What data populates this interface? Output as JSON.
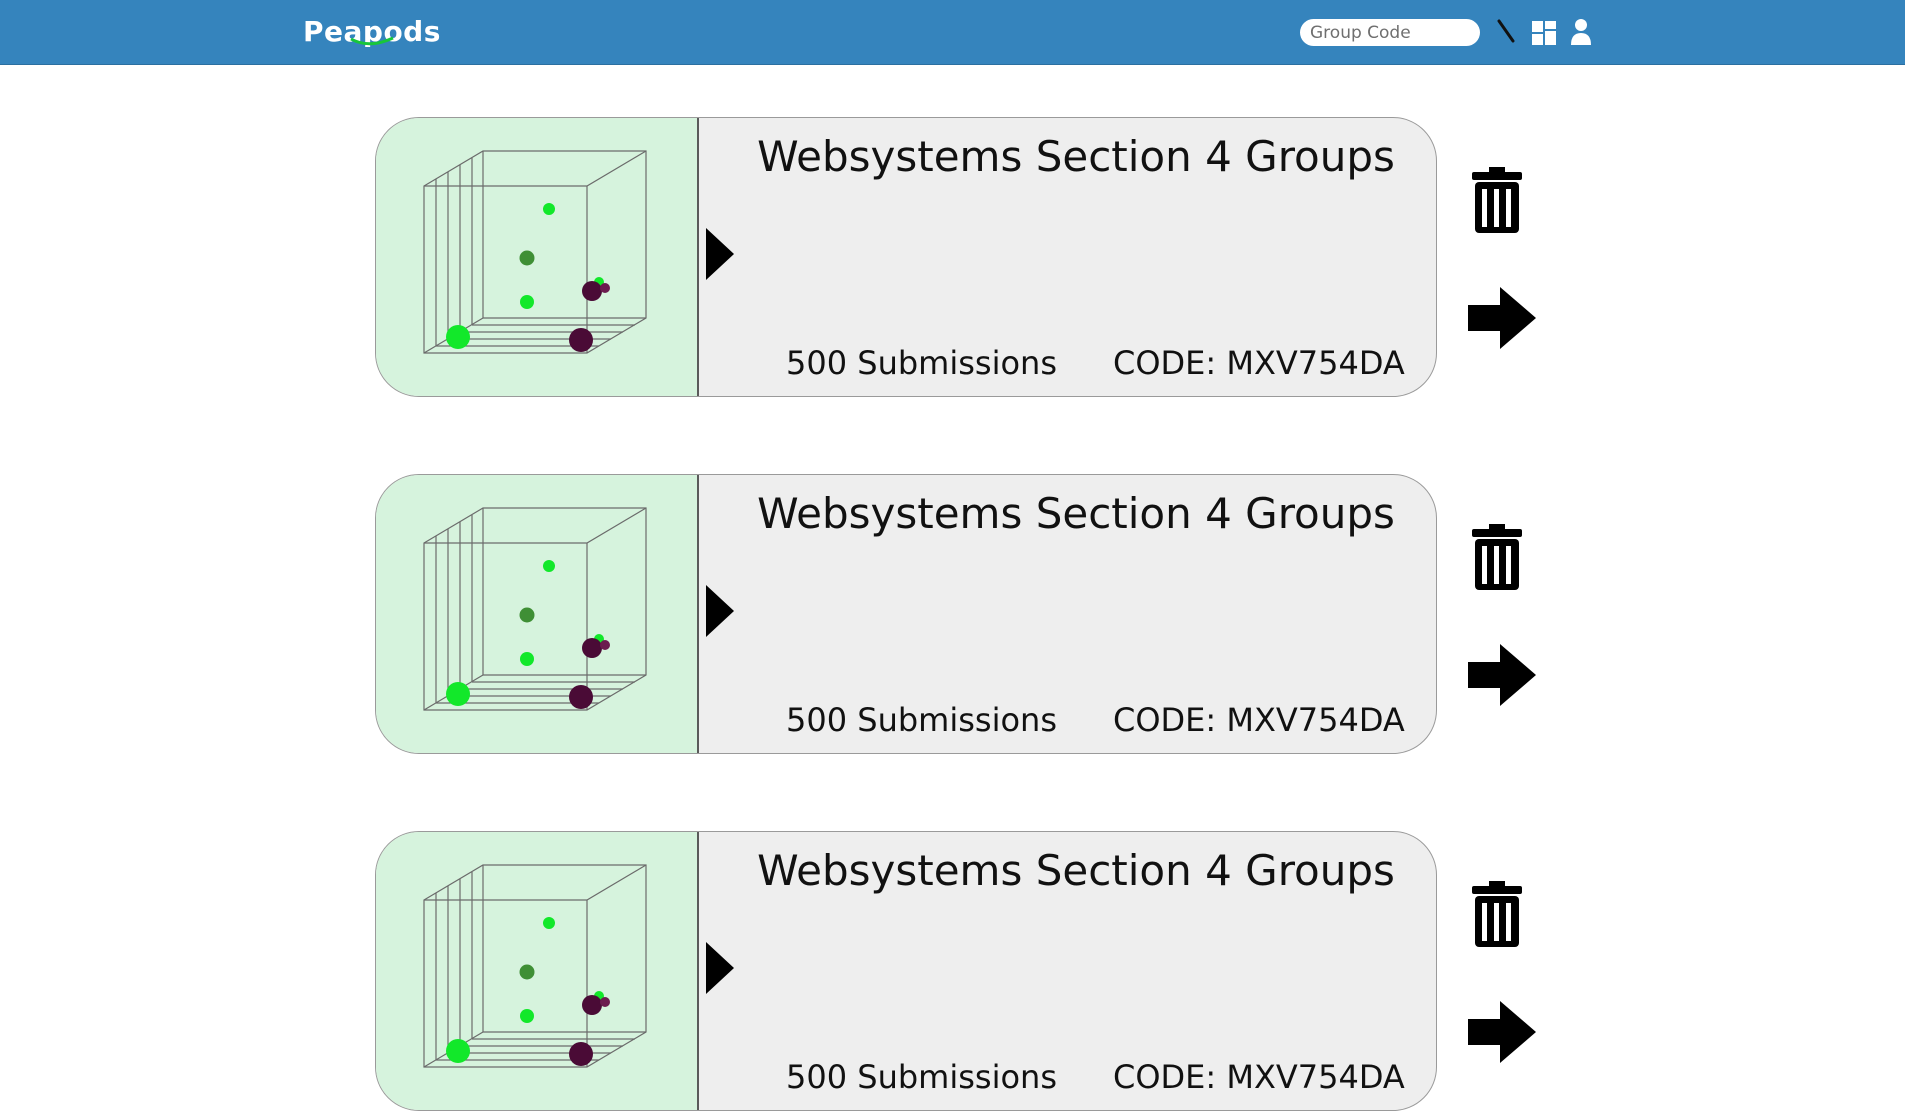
{
  "app": {
    "logo_text": "Peapods",
    "colors": {
      "header": "#3584bd",
      "thumb_bg": "#d6f3dd",
      "card_bg": "#eeeeee",
      "accent_green": "#00e000",
      "dark_dot": "#4a0b36"
    }
  },
  "header": {
    "group_code_placeholder": "Group Code",
    "icons": [
      "pen-icon",
      "dashboard-icon",
      "user-icon"
    ]
  },
  "groups": [
    {
      "title": "Websystems Section 4 Groups",
      "submissions": "500 Submissions",
      "code": "CODE: MXV754DA"
    },
    {
      "title": "Websystems Section 4 Groups",
      "submissions": "500 Submissions",
      "code": "CODE: MXV754DA"
    },
    {
      "title": "Websystems Section 4 Groups",
      "submissions": "500 Submissions",
      "code": "CODE: MXV754DA"
    }
  ]
}
